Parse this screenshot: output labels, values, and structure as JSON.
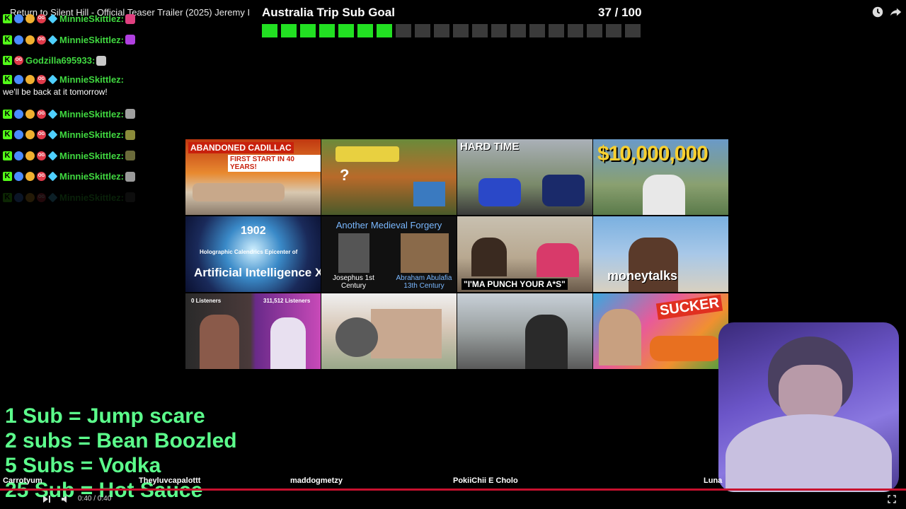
{
  "video": {
    "title": "Return to Silent Hill - Official Teaser Trailer (2025) Jeremy I",
    "time": "0:40 / 0:40"
  },
  "goal": {
    "title": "Australia Trip Sub Goal",
    "count_text": "37 / 100",
    "current": 37,
    "target": 100,
    "segments_total": 20,
    "segments_filled": 7,
    "fill_color": "#22e022"
  },
  "chat": {
    "messages": [
      {
        "user": "MinnieSkittlez:",
        "text": "",
        "faded": false
      },
      {
        "user": "MinnieSkittlez:",
        "text": "",
        "faded": false
      },
      {
        "user": "Godzilla695933:",
        "text": "",
        "faded": false
      },
      {
        "user": "MinnieSkittlez:",
        "text": "we'll be back at it tomorrow!",
        "faded": false
      },
      {
        "user": "MinnieSkittlez:",
        "text": "",
        "faded": false
      },
      {
        "user": "MinnieSkittlez:",
        "text": "",
        "faded": false
      },
      {
        "user": "MinnieSkittlez:",
        "text": "",
        "faded": false
      },
      {
        "user": "MinnieSkittlez:",
        "text": "",
        "faded": false
      },
      {
        "user": "MinnieSkittlez:",
        "text": "",
        "faded": true
      }
    ]
  },
  "thumbnails": [
    {
      "caption": "ABANDONED CADILLAC",
      "sub": "FIRST START IN 40 YEARS!"
    },
    {
      "caption": "",
      "sub": ""
    },
    {
      "caption": "HARD TIME",
      "sub": ""
    },
    {
      "caption": "$10,000,000",
      "sub": ""
    },
    {
      "caption": "1902",
      "sub": "Holographic Calendrics Epicenter of",
      "extra": "Artificial Intelligence X"
    },
    {
      "caption": "Another Medieval Forgery",
      "sub": "Josephus 1st Century",
      "extra": "Abraham Abulafia 13th Century"
    },
    {
      "caption": "\"I'MA PUNCH YOUR A*S\"",
      "sub": ""
    },
    {
      "caption": "moneytalks",
      "sub": ""
    },
    {
      "caption": "0 Listeners",
      "sub": "311,512 Listeners"
    },
    {
      "caption": "",
      "sub": ""
    },
    {
      "caption": "",
      "sub": ""
    },
    {
      "caption": "SUCKER",
      "sub": ""
    }
  ],
  "tiers": [
    "1 Sub = Jump scare",
    "2 subs = Bean Boozled",
    "5 Subs = Vodka",
    "25 Sub = Hot Sauce"
  ],
  "bottom_names": [
    "Carrotyum",
    "Theyluvcapalottt",
    "maddogmetzy",
    "PokiiChii E Cholo",
    "Luna"
  ],
  "colors": {
    "accent_green": "#5cff8c",
    "chat_green": "#40d840",
    "progress_red": "#c8102e"
  },
  "icons": {
    "clock": "clock-icon",
    "share": "share-icon"
  }
}
